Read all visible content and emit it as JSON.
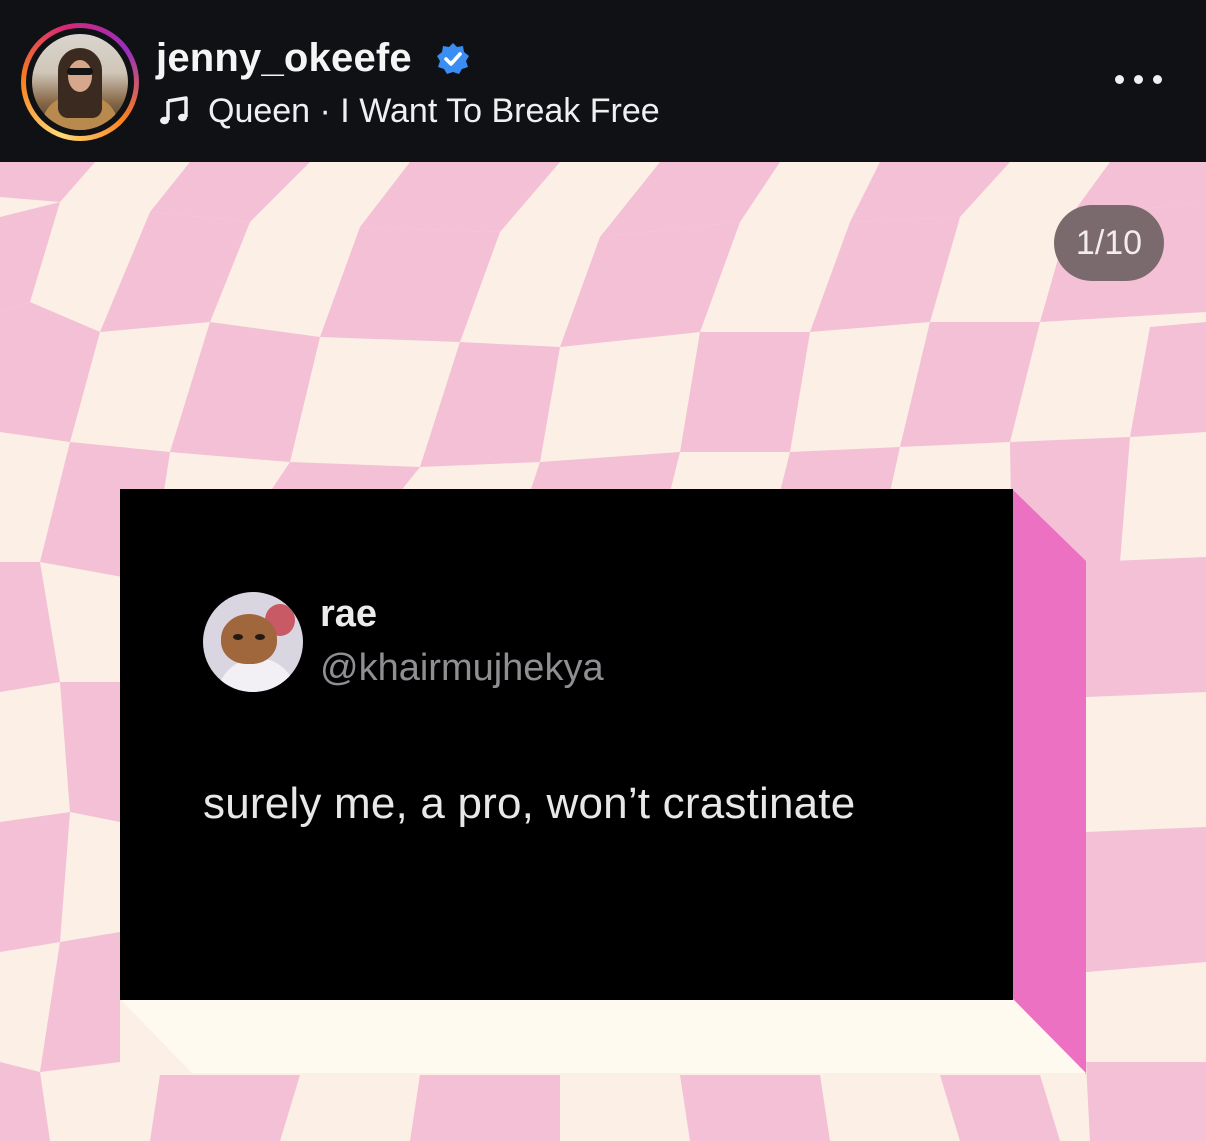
{
  "header": {
    "username": "jenny_okeefe",
    "verified": true,
    "song": "Queen · I Want To Break Free",
    "icons": [
      "avatar",
      "verified-badge-icon",
      "music-note-icon",
      "more-options-icon"
    ]
  },
  "post": {
    "counter": "1/10",
    "background_colors": {
      "pink": "#f3c0d6",
      "cream": "#fbefe6",
      "block_side": "#ec71c2",
      "block_bottom": "#fffaf0"
    },
    "tweet": {
      "name": "rae",
      "handle": "@khairmujhekya",
      "text": "surely me, a pro, won’t crastinate"
    }
  },
  "colors": {
    "header_bg": "#0f1115",
    "verified_blue": "#3a8df3",
    "counter_bg": "#7b6a6d"
  }
}
